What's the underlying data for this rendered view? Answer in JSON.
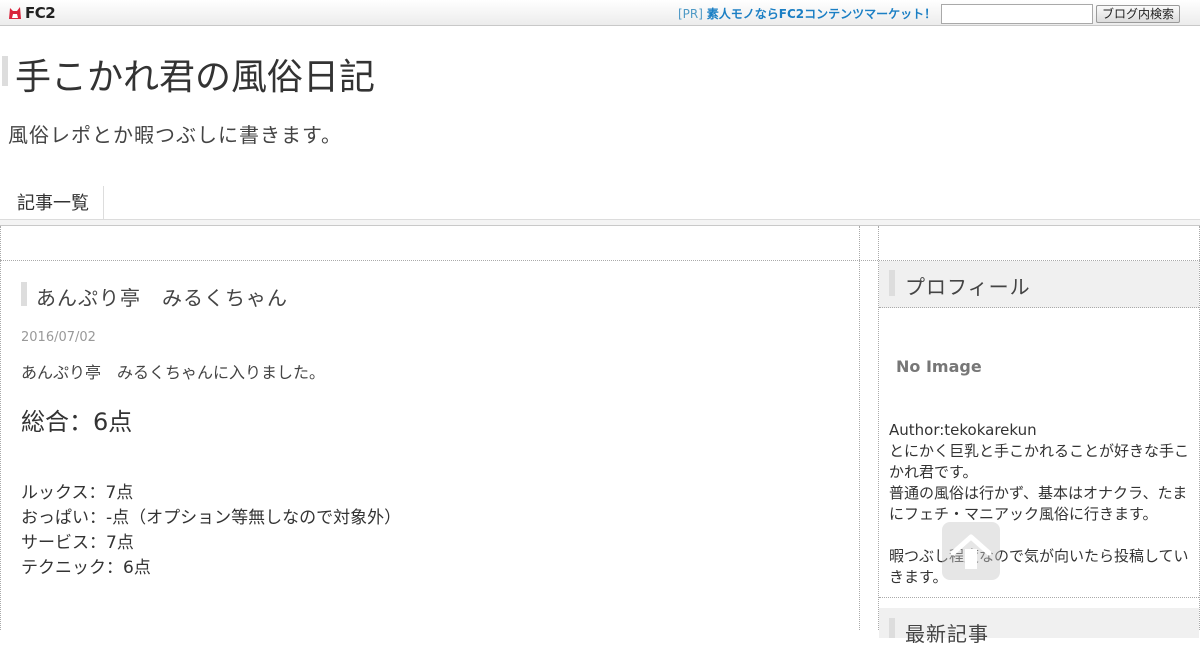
{
  "fc2bar": {
    "logo_text": "FC2",
    "pr_tag": "[PR]",
    "pr_link": "素人モノならFC2コンテンツマーケット！",
    "search_placeholder": "",
    "search_button": "ブログ内検索"
  },
  "header": {
    "title": "手こかれ君の風俗日記",
    "description": "風俗レポとか暇つぶしに書きます。"
  },
  "nav": {
    "items": [
      {
        "label": "記事一覧"
      }
    ]
  },
  "entry": {
    "title": "あんぷり亭　みるくちゃん",
    "date": "2016/07/02",
    "intro": "あんぷり亭　みるくちゃんに入りました。",
    "total": "総合：6点",
    "scores": [
      "ルックス：7点",
      "おっぱい：-点（オプション等無しなので対象外）",
      "サービス：7点",
      "テクニック：6点"
    ]
  },
  "sidebar": {
    "profile_title": "プロフィール",
    "no_image": "No Image",
    "author": "Author:tekokarekun",
    "bio1": "とにかく巨乳と手こかれることが好きな手こかれ君です。",
    "bio2": "普通の風俗は行かず、基本はオナクラ、たまにフェチ・マニアック風俗に行きます。",
    "bio3": "暇つぶし程度なので気が向いたら投稿していきます。",
    "latest_title": "最新記事"
  },
  "colors": {
    "link": "#1b7fc4",
    "heading_bar": "#dddddd",
    "date": "#999999"
  },
  "icons": {
    "logo": "fc2-fox-icon",
    "pagetop": "arrow-up-icon"
  }
}
